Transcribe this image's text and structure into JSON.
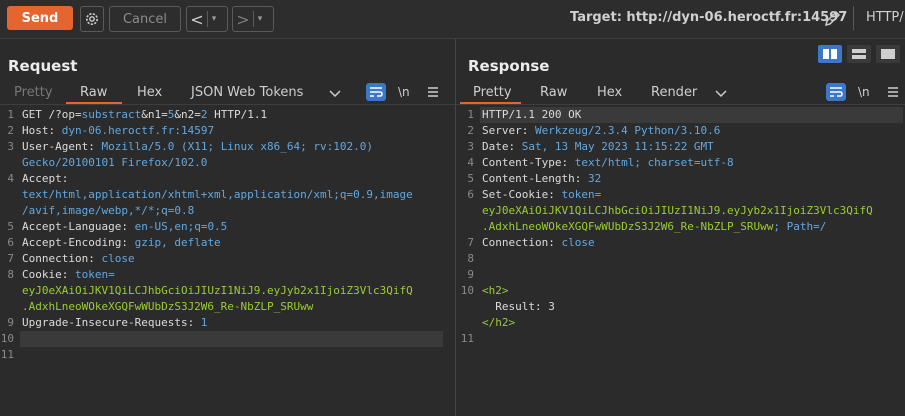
{
  "toolbar": {
    "send_label": "Send",
    "cancel_label": "Cancel",
    "back_glyph": "<",
    "forward_glyph": ">",
    "target_label": "Target: http://dyn-06.heroctf.fr:14597",
    "http_version_label": "HTTP/",
    "icons": [
      "gear-icon",
      "edit-icon"
    ],
    "colors": {
      "send": "#e4652f",
      "active_layout": "#3d78c8"
    }
  },
  "request": {
    "title": "Request",
    "tabs": [
      "Pretty",
      "Raw",
      "Hex",
      "JSON Web Tokens"
    ],
    "active_tab": "Raw",
    "newline_toggle": "\\n",
    "lines": [
      {
        "n": "1",
        "parts": [
          {
            "t": "GET /?op=",
            "c": "plain"
          },
          {
            "t": "substract",
            "c": "val"
          },
          {
            "t": "&n1=",
            "c": "plain"
          },
          {
            "t": "5",
            "c": "val"
          },
          {
            "t": "&n2=",
            "c": "plain"
          },
          {
            "t": "2",
            "c": "val"
          },
          {
            "t": " HTTP/1.1",
            "c": "plain"
          }
        ]
      },
      {
        "n": "2",
        "parts": [
          {
            "t": "Host:",
            "c": "plain"
          },
          {
            "t": " dyn-06.heroctf.fr:14597",
            "c": "val"
          }
        ]
      },
      {
        "n": "3",
        "parts": [
          {
            "t": "User-Agent:",
            "c": "plain"
          },
          {
            "t": " Mozilla/5.0 (X11; Linux x86_64; rv:102.0)",
            "c": "val"
          }
        ]
      },
      {
        "n": "",
        "parts": [
          {
            "t": "Gecko/20100101 Firefox/102.0",
            "c": "val"
          }
        ]
      },
      {
        "n": "4",
        "parts": [
          {
            "t": "Accept:",
            "c": "plain"
          }
        ]
      },
      {
        "n": "",
        "parts": [
          {
            "t": "text/html,application/xhtml+xml,application/xml;q=0.9,image",
            "c": "val"
          }
        ]
      },
      {
        "n": "",
        "parts": [
          {
            "t": "/avif,image/webp,*/*;q=0.8",
            "c": "val"
          }
        ]
      },
      {
        "n": "5",
        "parts": [
          {
            "t": "Accept-Language:",
            "c": "plain"
          },
          {
            "t": " en-US,en;q=0.5",
            "c": "val"
          }
        ]
      },
      {
        "n": "6",
        "parts": [
          {
            "t": "Accept-Encoding:",
            "c": "plain"
          },
          {
            "t": " gzip, deflate",
            "c": "val"
          }
        ]
      },
      {
        "n": "7",
        "parts": [
          {
            "t": "Connection:",
            "c": "plain"
          },
          {
            "t": " close",
            "c": "val"
          }
        ]
      },
      {
        "n": "8",
        "parts": [
          {
            "t": "Cookie:",
            "c": "plain"
          },
          {
            "t": " token=",
            "c": "val"
          }
        ]
      },
      {
        "n": "",
        "parts": [
          {
            "t": "eyJ0eXAiOiJKV1QiLCJhbGciOiJIUzI1NiJ9.eyJyb2x1IjoiZ3Vlc3QifQ",
            "c": "tok"
          }
        ]
      },
      {
        "n": "",
        "parts": [
          {
            "t": ".AdxhLneoWOkeXGQFwWUbDzS3J2W6_Re-NbZLP_SRUww",
            "c": "tok"
          }
        ]
      },
      {
        "n": "9",
        "parts": [
          {
            "t": "Upgrade-Insecure-Requests:",
            "c": "plain"
          },
          {
            "t": " 1",
            "c": "val"
          }
        ]
      },
      {
        "n": "10",
        "parts": []
      },
      {
        "n": "11",
        "parts": []
      }
    ]
  },
  "response": {
    "title": "Response",
    "tabs": [
      "Pretty",
      "Raw",
      "Hex",
      "Render"
    ],
    "active_tab": "Pretty",
    "newline_toggle": "\\n",
    "lines": [
      {
        "n": "1",
        "parts": [
          {
            "t": "HTTP/1.1 200 OK",
            "c": "plain"
          }
        ]
      },
      {
        "n": "2",
        "parts": [
          {
            "t": "Server:",
            "c": "plain"
          },
          {
            "t": " Werkzeug/2.3.4 Python/3.10.6",
            "c": "val"
          }
        ]
      },
      {
        "n": "3",
        "parts": [
          {
            "t": "Date:",
            "c": "plain"
          },
          {
            "t": " Sat, 13 May 2023 11:15:22 GMT",
            "c": "val"
          }
        ]
      },
      {
        "n": "4",
        "parts": [
          {
            "t": "Content-Type:",
            "c": "plain"
          },
          {
            "t": " text/html; charset=utf-8",
            "c": "val"
          }
        ]
      },
      {
        "n": "5",
        "parts": [
          {
            "t": "Content-Length:",
            "c": "plain"
          },
          {
            "t": " 32",
            "c": "val"
          }
        ]
      },
      {
        "n": "6",
        "parts": [
          {
            "t": "Set-Cookie:",
            "c": "plain"
          },
          {
            "t": " token=",
            "c": "val"
          }
        ]
      },
      {
        "n": "",
        "parts": [
          {
            "t": "eyJ0eXAiOiJKV1QiLCJhbGciOiJIUzI1NiJ9.eyJyb2x1IjoiZ3Vlc3QifQ",
            "c": "tok"
          }
        ]
      },
      {
        "n": "",
        "parts": [
          {
            "t": ".AdxhLneoWOkeXGQFwWUbDzS3J2W6_Re-NbZLP_SRUww",
            "c": "tok"
          },
          {
            "t": "; Path=/",
            "c": "val"
          }
        ]
      },
      {
        "n": "7",
        "parts": [
          {
            "t": "Connection:",
            "c": "plain"
          },
          {
            "t": " close",
            "c": "val"
          }
        ]
      },
      {
        "n": "8",
        "parts": []
      },
      {
        "n": "9",
        "parts": []
      },
      {
        "n": "10",
        "parts": [
          {
            "t": "<h2>",
            "c": "tok"
          }
        ]
      },
      {
        "n": "",
        "parts": [
          {
            "t": "  Result: 3",
            "c": "plain"
          }
        ]
      },
      {
        "n": "",
        "parts": [
          {
            "t": "</h2>",
            "c": "tok"
          }
        ]
      },
      {
        "n": "11",
        "parts": []
      }
    ]
  }
}
